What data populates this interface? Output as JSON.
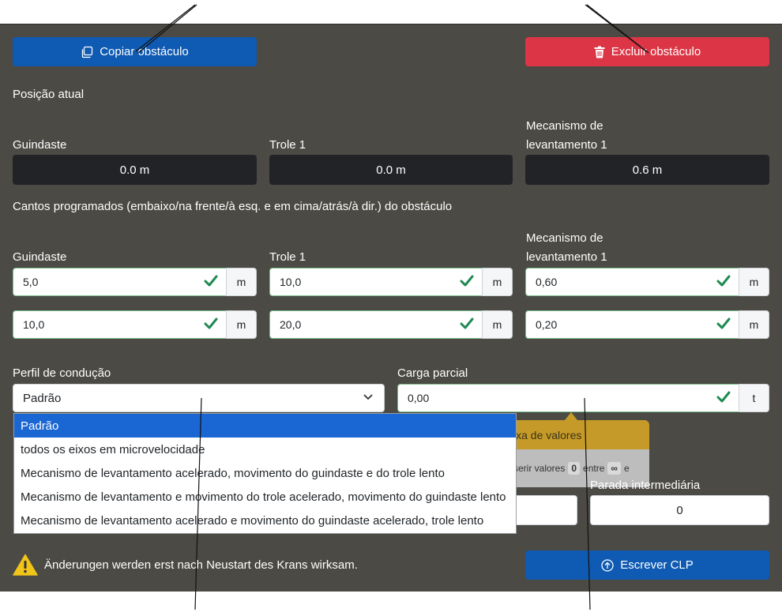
{
  "toolbar": {
    "copy_label": "Copiar obstáculo",
    "delete_label": "Excluir obstáculo"
  },
  "position": {
    "title": "Posição atual",
    "crane_label": "Guindaste",
    "crane_value": "0.0 m",
    "trolley_label": "Trole 1",
    "trolley_value": "0.0 m",
    "hoist_label_line1": "Mecanismo de",
    "hoist_label_line2": "levantamento 1",
    "hoist_value": "0.6 m"
  },
  "corners": {
    "title": "Cantos programados (embaixo/na frente/à esq. e em cima/atrás/à dir.) do obstáculo",
    "crane_label": "Guindaste",
    "trolley_label": "Trole 1",
    "hoist_label_line1": "Mecanismo de",
    "hoist_label_line2": "levantamento 1",
    "unit": "m",
    "row1": {
      "crane": "5,0",
      "trolley": "10,0",
      "hoist": "0,60"
    },
    "row2": {
      "crane": "10,0",
      "trolley": "20,0",
      "hoist": "0,20"
    }
  },
  "drive_profile": {
    "label": "Perfil de condução",
    "selected": "Padrão",
    "options": [
      "Padrão",
      "todos os eixos em microvelocidade",
      "Mecanismo de levantamento acelerado, movimento do guindaste e do trole lento",
      "Mecanismo de levantamento e movimento do trole acelerado, movimento do guindaste lento",
      "Mecanismo de levantamento acelerado e movimento do guindaste acelerado, trole lento"
    ]
  },
  "partial_load": {
    "label": "Carga parcial",
    "value": "0,00",
    "unit": "t"
  },
  "tooltip": {
    "title": "ixa de valores",
    "text_prefix": "serir valores",
    "min": "0",
    "between": "entre",
    "max": "∞",
    "suffix": "e"
  },
  "intermediate_stop": {
    "label": "Parada intermediária",
    "value": "0"
  },
  "footer": {
    "warning": "Änderungen werden erst nach Neustart des Krans wirksam.",
    "write_label": "Escrever CLP"
  },
  "colors": {
    "panel_bg": "#4b4a44",
    "primary": "#0f5ab2",
    "danger": "#dc3545",
    "valid": "#1e8a52",
    "warning": "#f0c419"
  }
}
